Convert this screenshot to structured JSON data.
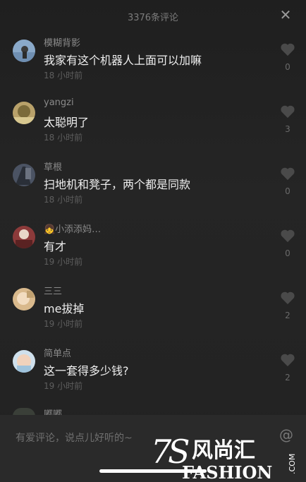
{
  "header": {
    "title": "3376条评论",
    "close": "✕"
  },
  "comments": [
    {
      "user": "模糊背影",
      "text": "我家有这个机器人上面可以加嘛",
      "time": "18 小时前",
      "likes": "0"
    },
    {
      "user": "yangzi",
      "text": "太聪明了",
      "time": "18 小时前",
      "likes": "3"
    },
    {
      "user": "草根",
      "text": "扫地机和凳子，两个都是同款",
      "time": "18 小时前",
      "likes": "0"
    },
    {
      "user": "👧小添添妈…",
      "text": "有才",
      "time": "19 小时前",
      "likes": "0"
    },
    {
      "user": "三三",
      "text": "me拔掉",
      "time": "19 小时前",
      "likes": "2"
    },
    {
      "user": "简单点",
      "text": "这一套得多少钱?",
      "time": "19 小时前",
      "likes": "2"
    }
  ],
  "peek_user": "嘟嘟",
  "input": {
    "placeholder": "有爱评论，说点儿好听的~"
  },
  "watermark": {
    "text": "7S风尚汇",
    "sub": "FASHION",
    "side": ".COM"
  },
  "colors": {
    "background": "#202020",
    "text": "#eeeeee",
    "muted": "#8a8a8a"
  },
  "icons": {
    "like": "heart-icon",
    "close": "close-icon",
    "mention": "at-icon"
  }
}
